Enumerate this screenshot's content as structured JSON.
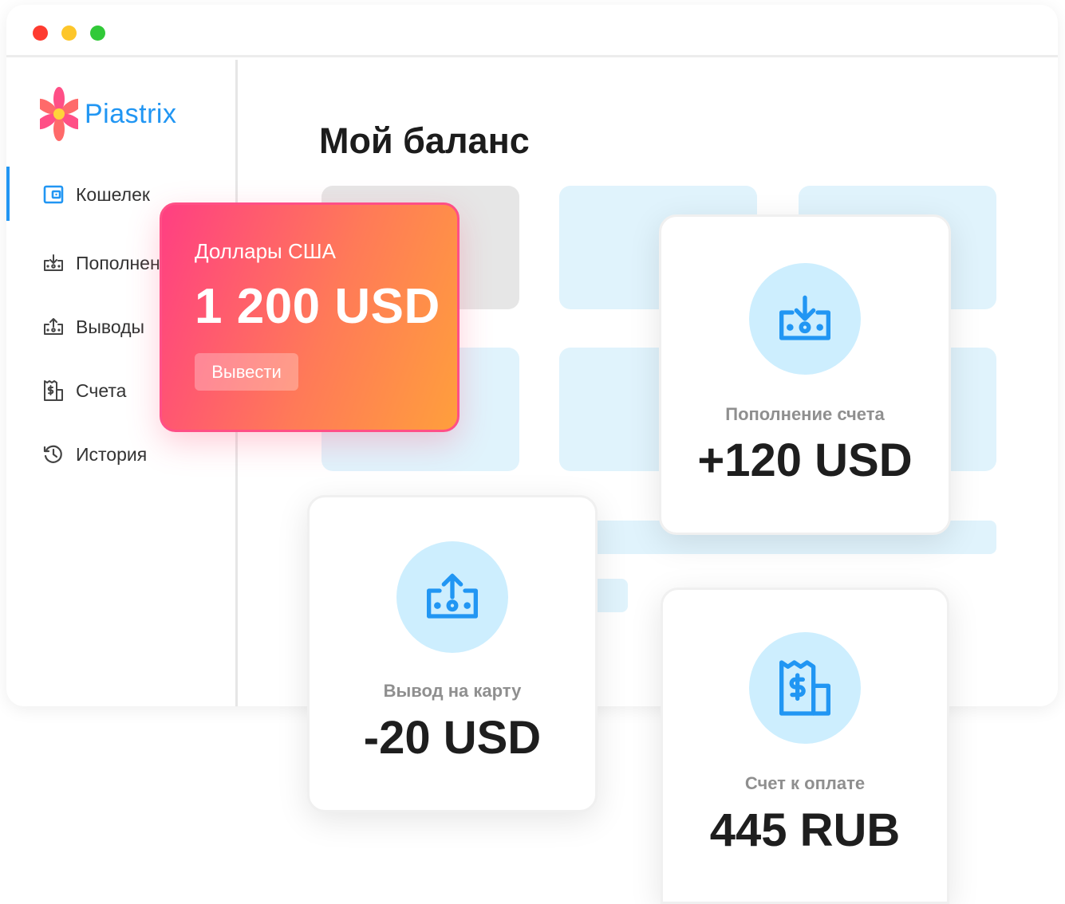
{
  "brand": {
    "name": "Piastrix"
  },
  "nav": {
    "items": [
      {
        "label": "Кошелек",
        "icon": "wallet-icon"
      },
      {
        "label": "Пополнения",
        "icon": "deposit-icon"
      },
      {
        "label": "Выводы",
        "icon": "withdraw-icon"
      },
      {
        "label": "Счета",
        "icon": "invoice-icon"
      },
      {
        "label": "История",
        "icon": "history-icon"
      }
    ]
  },
  "main": {
    "title": "Мой баланс"
  },
  "balance": {
    "currency_label": "Доллары США",
    "amount": "1 200 USD",
    "withdraw_label": "Вывести"
  },
  "cards": {
    "deposit": {
      "label": "Пополнение счета",
      "value": "+120 USD",
      "icon": "deposit-icon"
    },
    "withdrawal": {
      "label": "Вывод на карту",
      "value": "-20 USD",
      "icon": "withdraw-icon"
    },
    "invoice": {
      "label": "Счет к оплате",
      "value": "445 RUB",
      "icon": "invoice-icon"
    }
  },
  "colors": {
    "accent": "#2196f3",
    "balance_gradient_start": "#ff3f82",
    "balance_gradient_end": "#ff9f3c",
    "icon_circle": "#cdeefe"
  }
}
